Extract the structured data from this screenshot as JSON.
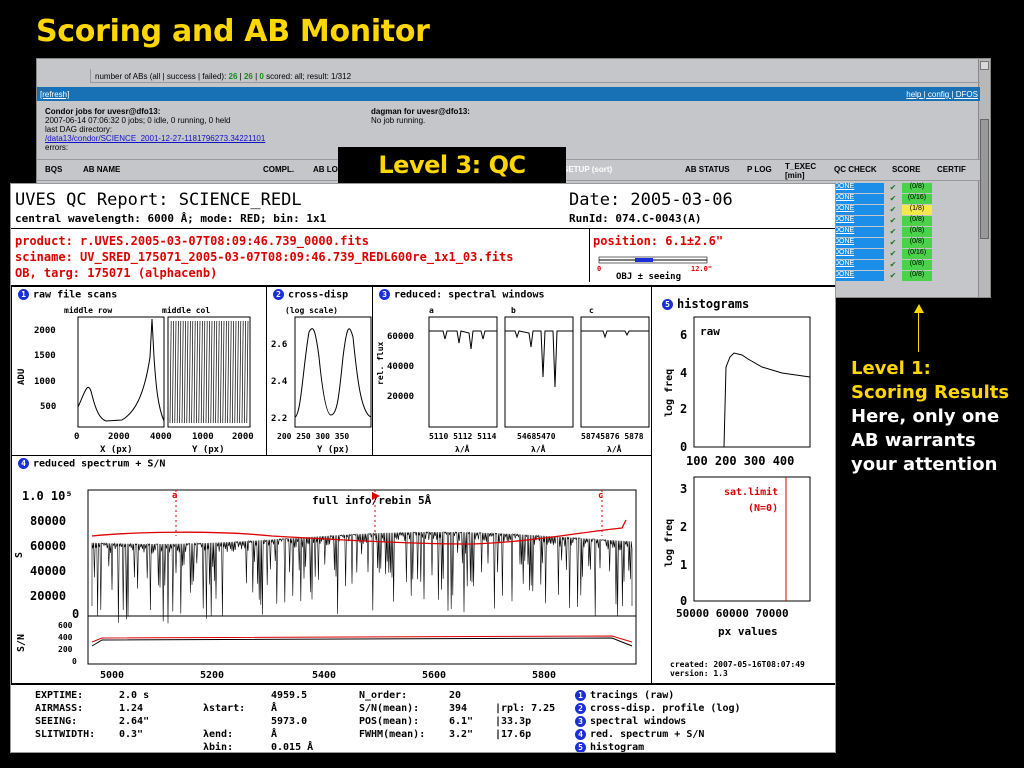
{
  "slide": {
    "title": "Scoring and AB Monitor",
    "level3": "Level 3:  QC Report",
    "level1_lines": [
      "Level 1:",
      "Scoring Results",
      "Here, only one",
      "AB warrants",
      "your attention"
    ]
  },
  "ab_monitor": {
    "summary_prefix": "number of ABs (all | success | failed): ",
    "summary_all": "26",
    "summary_sep1": " | ",
    "summary_success": "26",
    "summary_sep2": " | ",
    "summary_failed": "0",
    "summary_suffix": "     scored: all; result: 1/312",
    "refresh": "[refresh]",
    "links": "help | config | DFOS",
    "condor_title": "Condor jobs for uvesr@dfo13:",
    "condor_line1": "2007-06-14 07:06:32 0 jobs; 0 idle, 0 running, 0 held",
    "condor_line2": "last DAG directory:",
    "condor_path": "/data13/condor/SCIENCE_2001-12-27-1181796273.34221101",
    "condor_errors": "errors:",
    "dagman_title": "dagman for uvesr@dfo13:",
    "dagman_status": "No job running.",
    "headers": [
      "BQS",
      "AB NAME",
      "COMPL.",
      "AB LO",
      "SETUP (sort)",
      "AB STATUS",
      "P LOG",
      "T_EXEC [min]",
      "QC CHECK",
      "SCORE",
      "CERTIF"
    ],
    "rows": [
      {
        "qc": "DONE",
        "check": "✔",
        "score": "(0/8)",
        "flag": "ok"
      },
      {
        "qc": "DONE",
        "check": "✔",
        "score": "(0/16)",
        "flag": "ok"
      },
      {
        "qc": "DONE",
        "check": "✔",
        "score": "(1/8)",
        "flag": "warn"
      },
      {
        "qc": "DONE",
        "check": "✔",
        "score": "(0/8)",
        "flag": "ok"
      },
      {
        "qc": "DONE",
        "check": "✔",
        "score": "(0/8)",
        "flag": "ok"
      },
      {
        "qc": "DONE",
        "check": "✔",
        "score": "(0/8)",
        "flag": "ok"
      },
      {
        "qc": "DONE",
        "check": "✔",
        "score": "(0/16)",
        "flag": "ok"
      },
      {
        "qc": "DONE",
        "check": "✔",
        "score": "(0/8)",
        "flag": "ok"
      },
      {
        "qc": "DONE",
        "check": "✔",
        "score": "(0/8)",
        "flag": "ok"
      }
    ]
  },
  "qc": {
    "title": "UVES QC Report: SCIENCE_REDL",
    "subtitle": "central wavelength: 6000 Å; mode: RED; bin: 1x1",
    "date": "Date: 2005-03-06",
    "runid": "RunId: 074.C-0043(A)",
    "product": "product:  r.UVES.2005-03-07T08:09:46.739_0000.fits",
    "sciname": "sciname:  UV_SRED_175071_2005-03-07T08:09:46.739_REDL600re_1x1_03.fits",
    "ob": "OB, targ:  175071 (alphacenb)",
    "position": "position:  6.1±2.6\"",
    "seeing_lo": "0",
    "seeing_hi": "12.0\"",
    "seeing_label": "OBJ ± seeing",
    "panels": {
      "p1": {
        "num": "1",
        "title": "raw file scans",
        "sub1": "middle row",
        "sub2": "middle col",
        "ylabel": "ADU",
        "xlabel": "X (px)",
        "xlabel2": "Y (px)",
        "y_ticks": [
          "2000",
          "1500",
          "1000",
          "500"
        ],
        "x_ticks": [
          "0",
          "2000",
          "4000"
        ],
        "x_ticks2": [
          "1000",
          "2000"
        ]
      },
      "p2": {
        "num": "2",
        "title": "cross-disp",
        "sub": "(log scale)",
        "y_ticks": [
          "2.6",
          "2.4",
          "2.2"
        ],
        "x_ticks": "200 250 300 350",
        "xlabel": "Y (px)"
      },
      "p3": {
        "num": "3",
        "title": "reduced: spectral windows",
        "labels": [
          "a",
          "b",
          "c"
        ],
        "ylabel": "rel. flux",
        "y_ticks": [
          "60000",
          "40000",
          "20000"
        ],
        "x_ticks": [
          "5110 5112 5114",
          "54685470",
          "58745876 5878"
        ],
        "xlabel": "λ/Å"
      },
      "p4": {
        "num": "4",
        "title": "reduced spectrum + S/N",
        "full_info": "full info/rebin 5Å",
        "y_ticks": [
          "1.0 10⁵",
          "80000",
          "60000",
          "40000",
          "20000",
          "0"
        ],
        "ylabel": "S",
        "sn_label": "S/N",
        "sn_ticks": [
          "600",
          "400",
          "200",
          "0"
        ],
        "x_ticks": [
          "5000",
          "5200",
          "5400",
          "5600",
          "5800"
        ],
        "markers": [
          "a",
          "b",
          "c"
        ]
      },
      "p5": {
        "num": "5",
        "title": "histograms",
        "raw": "raw",
        "ylabel": "log freq",
        "y_ticks": [
          "6",
          "4",
          "2",
          "0"
        ],
        "x_ticks": "100  200  300  400",
        "y_ticks2": [
          "3",
          "2",
          "1",
          "0"
        ],
        "sat": "sat.limit",
        "sat_n": "(N=0)",
        "x_ticks2": "50000  60000  70000",
        "xlabel": "px values",
        "created": "created: 2007-05-16T08:07:49",
        "version": "version: 1.3"
      }
    },
    "params1": [
      [
        "EXPTIME:",
        "2.0 s"
      ],
      [
        "AIRMASS:",
        "1.24"
      ],
      [
        "SEEING:",
        "2.64\""
      ],
      [
        "SLITWIDTH:",
        "0.3\""
      ]
    ],
    "params2": [
      [
        "λstart:",
        "4959.5 Å"
      ],
      [
        "λend:",
        "5973.0 Å"
      ],
      [
        "λbin:",
        "0.015 Å"
      ]
    ],
    "params3": [
      [
        "N_order:",
        "20",
        ""
      ],
      [
        "S/N(mean):",
        "394",
        "|rpl: 7.25"
      ],
      [
        "POS(mean):",
        "6.1\"",
        "|33.3p"
      ],
      [
        "FWHM(mean):",
        "3.2\"",
        "|17.6p"
      ]
    ],
    "legend": [
      "tracings (raw)",
      "cross-disp. profile (log)",
      "spectral windows",
      "red. spectrum + S/N",
      "histogram"
    ]
  }
}
